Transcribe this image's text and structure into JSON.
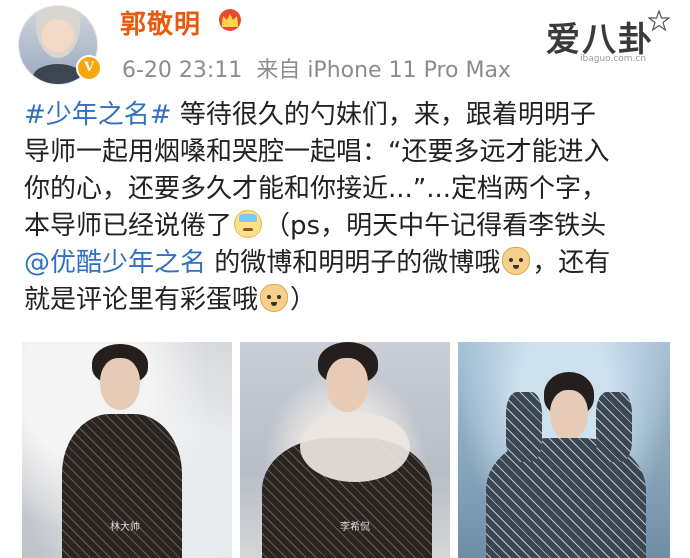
{
  "header": {
    "username": "郭敬明",
    "time": "6-20 23:11",
    "source": "来自 iPhone 11 Pro Max",
    "verified_badge": "V"
  },
  "brand": {
    "text": "爱八卦",
    "url": "ibaguo.com.cn"
  },
  "post": {
    "hashtag": "#少年之名#",
    "line1_rest": " 等待很久的勺妹们，来，跟着明明子",
    "line2": "导师一起用烟嗓和哭腔一起唱：“还要多远才能进入",
    "line3": "你的心，还要多久才能和你接近...”...定档两个字，",
    "line4a": "本导师已经说倦了",
    "line4b": "（ps，明天中午记得看李铁头",
    "mention": "@优酷少年之名",
    "line5b": " 的微博和明明子的微博哦",
    "line5c": "，还有",
    "line6a": "就是评论里有彩蛋哦",
    "line6b": "）"
  },
  "icons": {
    "crown": "crown-icon",
    "verified": "verified-v-icon",
    "emoji_sweat": "sweat-emoji",
    "emoji_doge": "doge-emoji"
  },
  "photos": [
    {
      "caption": "林大帅"
    },
    {
      "caption": "李希侃"
    },
    {
      "caption": ""
    }
  ],
  "colors": {
    "username": "#e8590c",
    "link": "#2f6fc4",
    "meta": "#8c8c8c"
  }
}
